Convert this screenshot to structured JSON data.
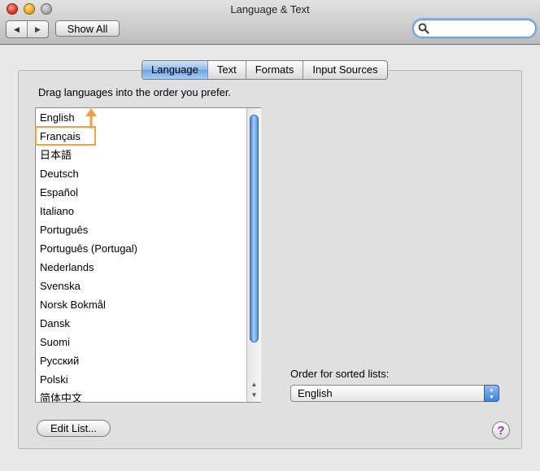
{
  "window": {
    "title": "Language & Text",
    "buttons": [
      "close",
      "minimize",
      "zoom"
    ]
  },
  "toolbar": {
    "back_icon": "◀",
    "forward_icon": "▶",
    "show_all_label": "Show All",
    "search": {
      "value": "",
      "placeholder": ""
    }
  },
  "tabs": [
    {
      "label": "Language",
      "selected": true
    },
    {
      "label": "Text",
      "selected": false
    },
    {
      "label": "Formats",
      "selected": false
    },
    {
      "label": "Input Sources",
      "selected": false
    }
  ],
  "language_pane": {
    "instruction": "Drag languages into the order you prefer.",
    "languages": [
      "English",
      "Français",
      "日本語",
      "Deutsch",
      "Español",
      "Italiano",
      "Português",
      "Português (Portugal)",
      "Nederlands",
      "Svenska",
      "Norsk Bokmål",
      "Dansk",
      "Suomi",
      "Русский",
      "Polski",
      "简体中文"
    ],
    "highlighted_language": "Français",
    "drag_annotation_color": "#f0a048",
    "sorted_lists_label": "Order for sorted lists:",
    "sorted_lists_value": "English",
    "edit_list_label": "Edit List...",
    "help_label": "?"
  },
  "colors": {
    "accent": "#6ea4e3",
    "annotation": "#f0a048"
  }
}
